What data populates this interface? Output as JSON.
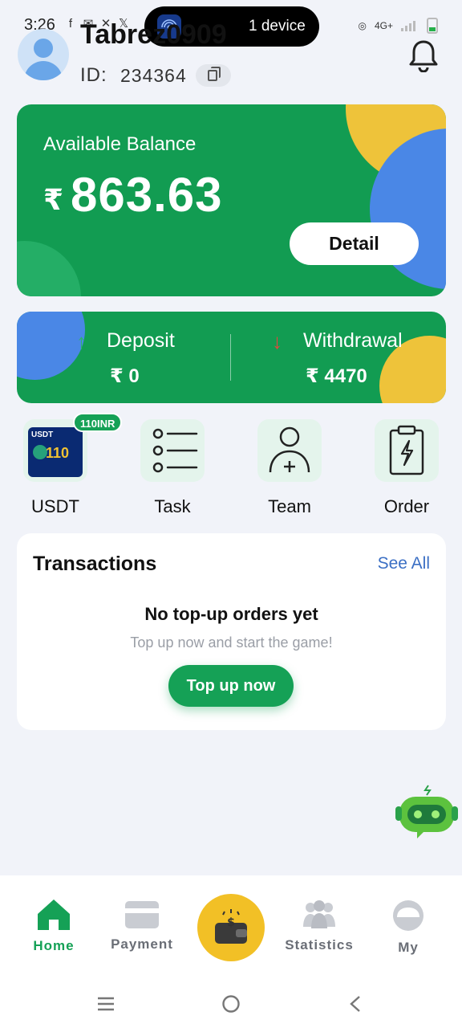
{
  "status_bar": {
    "time": "3:26",
    "device_label": "1 device",
    "network": "4G+"
  },
  "user": {
    "name": "Tabrez0909",
    "id_label": "ID:",
    "id": "234364"
  },
  "balance": {
    "label": "Available Balance",
    "currency": "₹",
    "amount": "863.63",
    "detail_label": "Detail"
  },
  "deposit": {
    "label": "Deposit",
    "value": "₹ 0"
  },
  "withdrawal": {
    "label": "Withdrawal",
    "value": "₹ 4470"
  },
  "shortcuts": [
    {
      "label": "USDT",
      "badge": "110INR",
      "icon": "usdt-icon"
    },
    {
      "label": "Task",
      "icon": "list-icon"
    },
    {
      "label": "Team",
      "icon": "add-user-icon"
    },
    {
      "label": "Order",
      "icon": "clipboard-bolt-icon"
    }
  ],
  "usdt_image": {
    "brand": "USDT",
    "amount": "110"
  },
  "transactions": {
    "title": "Transactions",
    "see_all": "See All",
    "empty_title": "No top-up orders yet",
    "empty_subtitle": "Top up now and start the game!",
    "cta": "Top up now"
  },
  "bottom_nav": [
    {
      "label": "Home",
      "icon": "home-icon",
      "active": true
    },
    {
      "label": "Payment",
      "icon": "card-icon",
      "active": false
    },
    {
      "label": "",
      "icon": "wallet-icon",
      "active": false
    },
    {
      "label": "Statistics",
      "icon": "group-icon",
      "active": false
    },
    {
      "label": "My",
      "icon": "profile-icon",
      "active": false
    }
  ],
  "colors": {
    "brand_green": "#129c52",
    "accent_yellow": "#eec33a",
    "accent_blue": "#4a87e6",
    "link_blue": "#3b6fc4"
  }
}
